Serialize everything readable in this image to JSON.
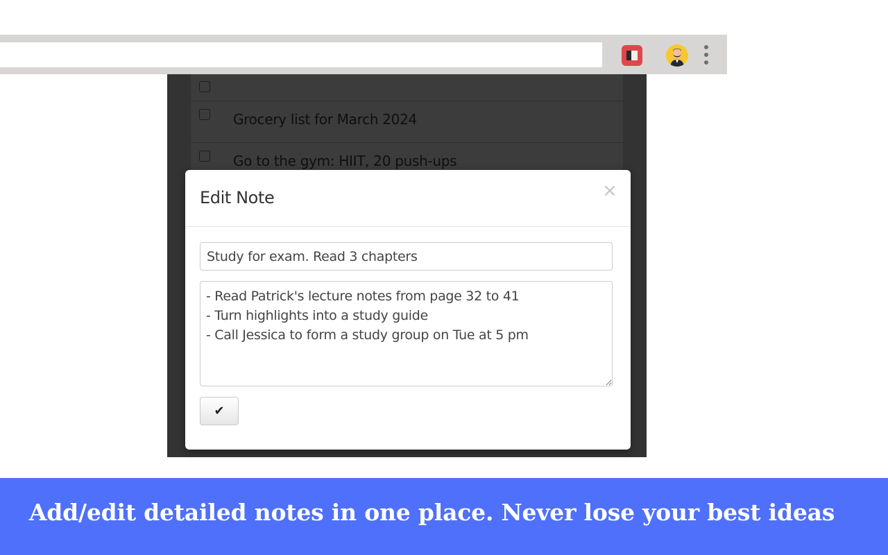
{
  "browser": {
    "omnibox_value": "",
    "extension_icon": "notebook-icon",
    "avatar_icon": "user-avatar-icon",
    "menu_icon": "kebab-menu-icon"
  },
  "notes_list": {
    "items": [
      {
        "label": "",
        "checked": false
      },
      {
        "label": "Grocery list for March 2024",
        "checked": false
      },
      {
        "label": "Go to the gym: HIIT, 20 push-ups",
        "checked": false
      }
    ]
  },
  "modal": {
    "title": "Edit Note",
    "close_glyph": "×",
    "title_field_value": "Study for exam. Read 3 chapters",
    "body_value": "- Read Patrick's lecture notes from page 32 to 41\n- Turn highlights into a study guide\n- Call Jessica to form a study group on Tue at 5 pm",
    "save_glyph": "✔"
  },
  "banner": {
    "text": "Add/edit detailed notes in one place. Never lose your best ideas"
  },
  "colors": {
    "banner": "#4f70fa",
    "toolbar": "#d8d6d5",
    "overlay": "#333333",
    "extension_icon": "#e0474c",
    "avatar_bg": "#f6c934"
  }
}
